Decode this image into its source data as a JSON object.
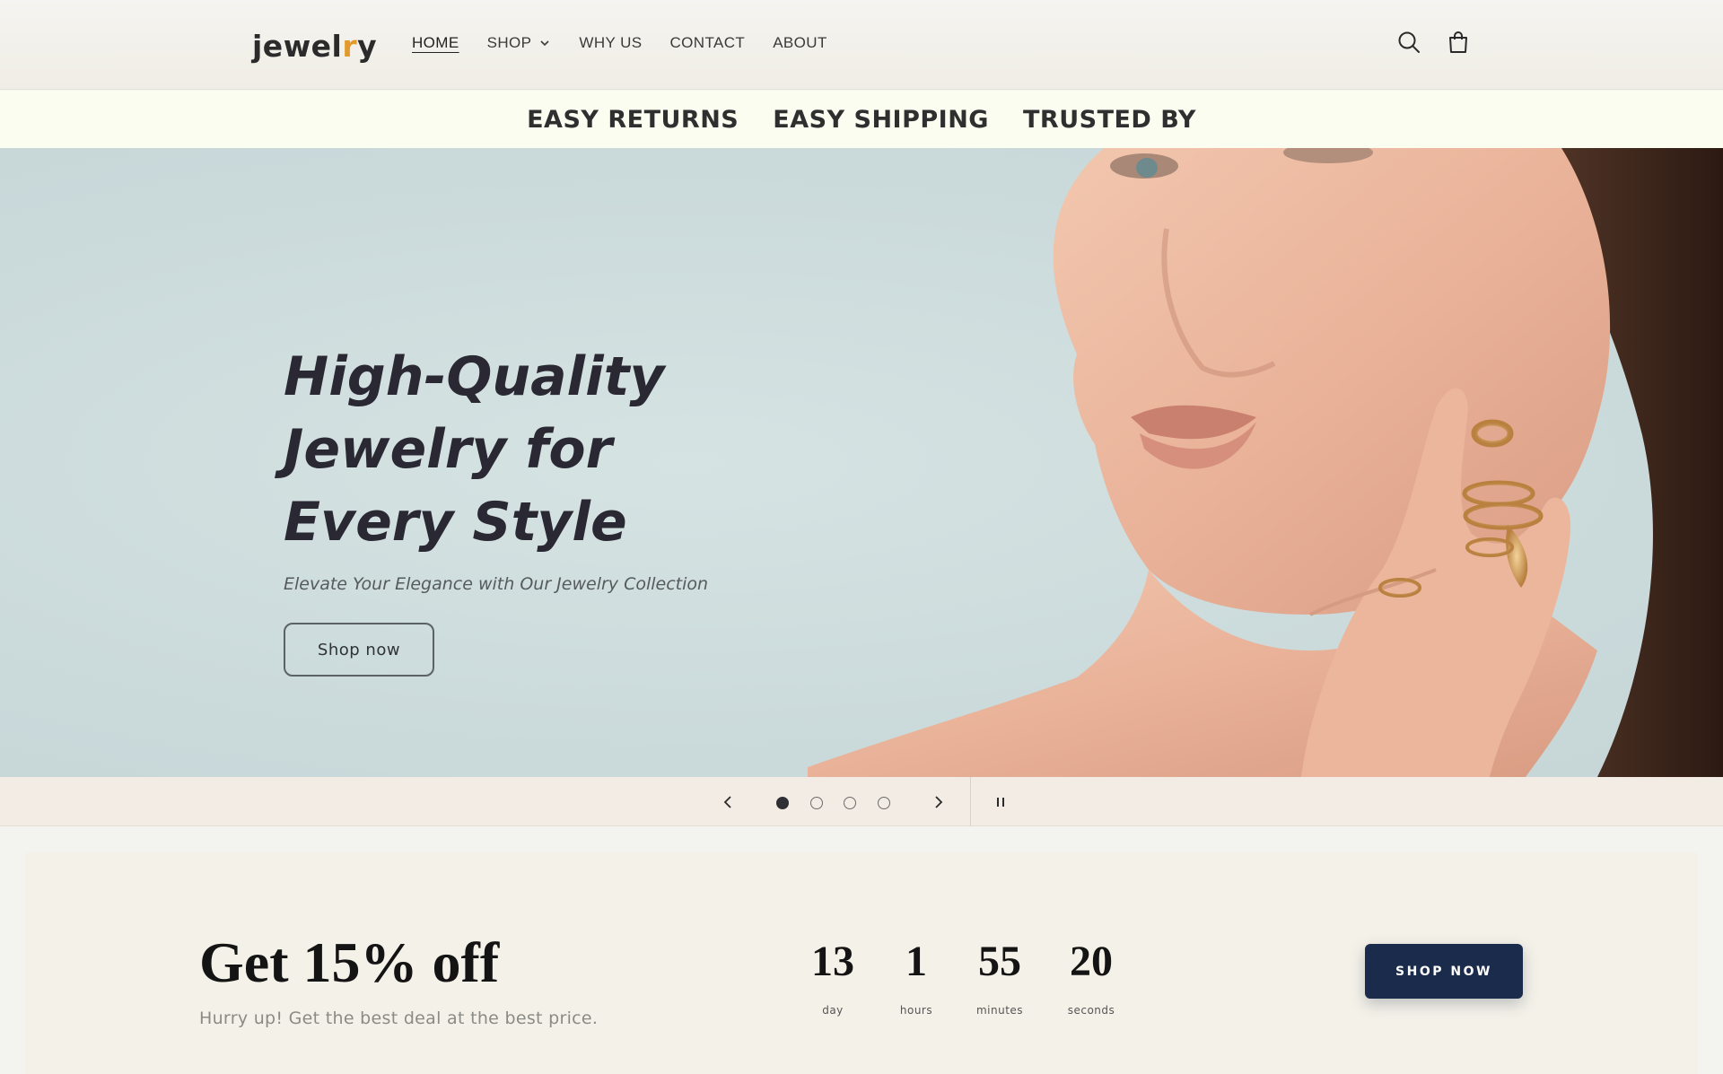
{
  "header": {
    "logo_text": "jewel",
    "logo_accent": "r",
    "logo_tail": "y",
    "nav": [
      {
        "label": "HOME",
        "active": true
      },
      {
        "label": "SHOP",
        "has_dropdown": true
      },
      {
        "label": "WHY US"
      },
      {
        "label": "CONTACT"
      },
      {
        "label": "ABOUT"
      }
    ],
    "icons": [
      "search-icon",
      "cart-icon"
    ]
  },
  "marquee": {
    "items": [
      "EASY RETURNS",
      "EASY SHIPPING",
      "TRUSTED BY"
    ]
  },
  "hero": {
    "title": "High-Quality Jewelry for Every Style",
    "subtitle": "Elevate Your Elegance with Our Jewelry Collection",
    "button_label": "Shop now"
  },
  "slider": {
    "slide_count": 4,
    "active_slide": 1,
    "icons": [
      "chevron-left-icon",
      "chevron-right-icon",
      "pause-icon"
    ]
  },
  "promo": {
    "title": "Get 15% off",
    "subtitle": "Hurry up! Get the best deal at the best price.",
    "countdown": [
      {
        "value": "13",
        "label": "day"
      },
      {
        "value": "1",
        "label": "hours"
      },
      {
        "value": "55",
        "label": "minutes"
      },
      {
        "value": "20",
        "label": "seconds"
      }
    ],
    "button_label": "SHOP NOW"
  },
  "colors": {
    "accent": "#e39a2d",
    "button_dark": "#1b2b4b",
    "hero_bg": "#cbdadb",
    "marquee_bg": "#fbfdf1"
  }
}
